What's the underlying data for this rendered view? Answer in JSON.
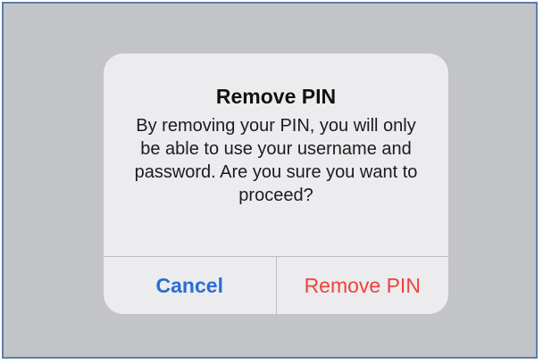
{
  "alert": {
    "title": "Remove PIN",
    "message": "By removing your PIN, you will only be able to use your username and password. Are you sure you want to proceed?",
    "cancel_label": "Cancel",
    "confirm_label": "Remove PIN"
  },
  "colors": {
    "backdrop": "#c3c4c8",
    "dialog_background": "#ececee",
    "cancel_text": "#2a6dd0",
    "destructive_text": "#f0423a",
    "frame_border": "#5d7ea8"
  }
}
